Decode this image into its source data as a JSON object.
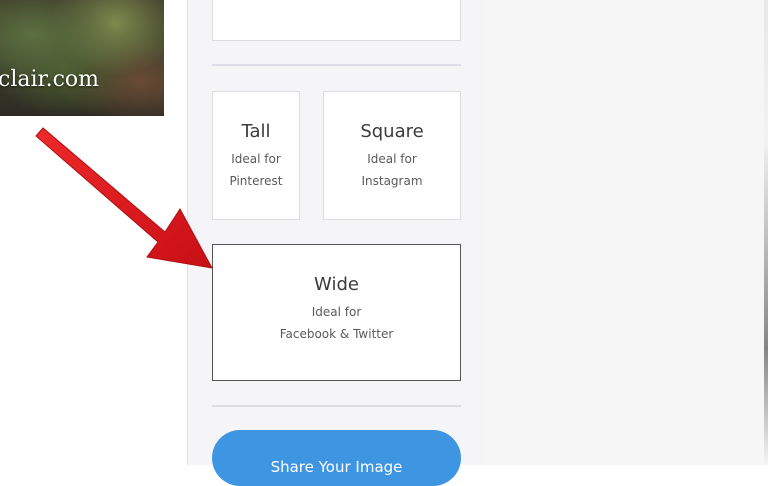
{
  "thumbnail": {
    "overlay_text": "clair.com"
  },
  "formats": {
    "tall": {
      "title": "Tall",
      "desc_line1": "Ideal for",
      "desc_line2": "Pinterest"
    },
    "square": {
      "title": "Square",
      "desc_line1": "Ideal for",
      "desc_line2": "Instagram"
    },
    "wide": {
      "title": "Wide",
      "desc_line1": "Ideal for",
      "desc_line2": "Facebook & Twitter"
    },
    "selected": "wide"
  },
  "share_button": {
    "label": "Share Your Image"
  },
  "colors": {
    "accent": "#3e96e2",
    "arrow": "#e0161e",
    "panel_bg": "#f5f5f7"
  }
}
